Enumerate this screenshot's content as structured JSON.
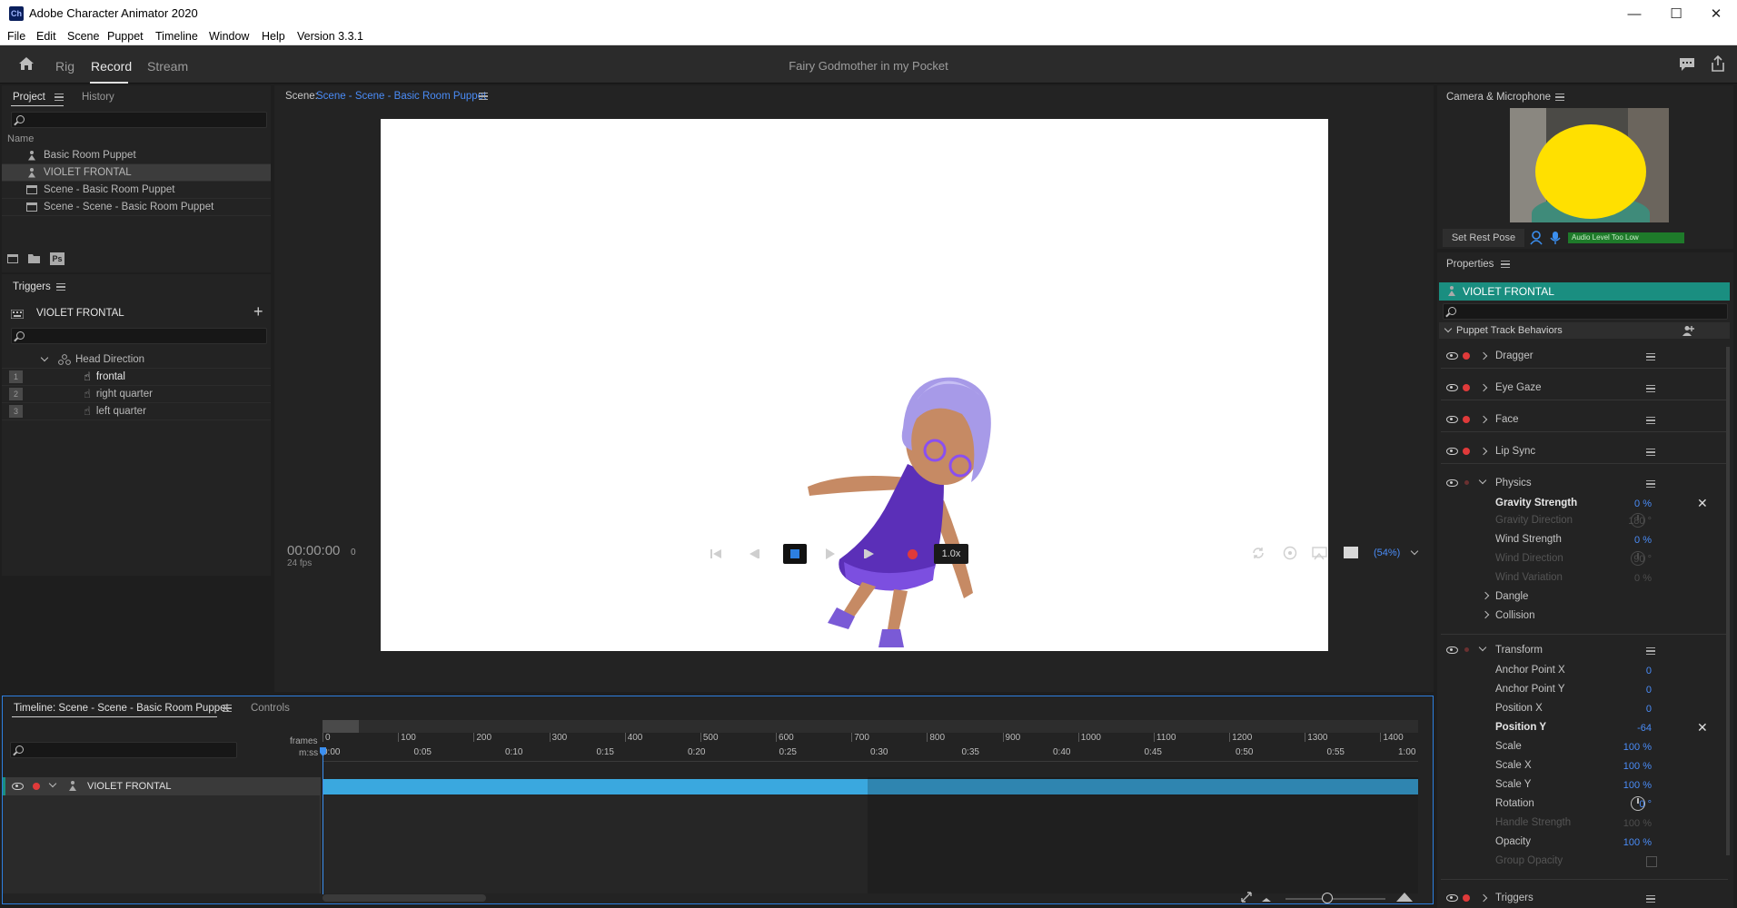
{
  "app": {
    "title": "Adobe Character Animator 2020",
    "icon_text": "Ch",
    "menu": [
      "File",
      "Edit",
      "Scene",
      "Puppet",
      "Timeline",
      "Window",
      "Help",
      "Version 3.3.1"
    ]
  },
  "workspaces": {
    "tabs": [
      "Rig",
      "Record",
      "Stream"
    ],
    "active": "Record",
    "document_title": "Fairy Godmother in my Pocket"
  },
  "project_panel": {
    "tabs": [
      "Project",
      "History"
    ],
    "column_header": "Name",
    "items": [
      {
        "type": "puppet",
        "name": "Basic Room Puppet"
      },
      {
        "type": "puppet",
        "name": "VIOLET FRONTAL",
        "selected": true
      },
      {
        "type": "scene",
        "name": "Scene - Basic Room Puppet"
      },
      {
        "type": "scene",
        "name": "Scene - Scene - Basic Room Puppet"
      }
    ],
    "footer_icons": [
      "new-scene-icon",
      "folder-icon",
      "photoshop-icon"
    ],
    "ps_label": "Ps"
  },
  "triggers_panel": {
    "title": "Triggers",
    "puppet": "VIOLET FRONTAL",
    "group": "Head Direction",
    "items": [
      {
        "key": "1",
        "name": "frontal",
        "active": true
      },
      {
        "key": "2",
        "name": "right quarter",
        "active": false
      },
      {
        "key": "3",
        "name": "left quarter",
        "active": false
      }
    ]
  },
  "scene_panel": {
    "label": "Scene:",
    "scene_name": "Scene - Scene - Basic Room Puppet",
    "timecode": "00:00:00",
    "frame": "0",
    "fps": "24 fps",
    "speed": "1.0x",
    "zoom": "(54%)"
  },
  "camera_panel": {
    "title": "Camera & Microphone",
    "set_rest_pose": "Set Rest Pose",
    "audio_status": "Audio Level Too Low"
  },
  "properties_panel": {
    "title": "Properties",
    "puppet": "VIOLET FRONTAL",
    "section": "Puppet Track Behaviors",
    "behaviors": [
      "Dragger",
      "Eye Gaze",
      "Face",
      "Lip Sync",
      "Physics",
      "Transform",
      "Triggers"
    ],
    "physics": {
      "gravity_strength": {
        "label": "Gravity Strength",
        "value": "0 %"
      },
      "gravity_direction": {
        "label": "Gravity Direction",
        "value": "180 °"
      },
      "wind_strength": {
        "label": "Wind Strength",
        "value": "0 %"
      },
      "wind_direction": {
        "label": "Wind Direction",
        "value": "90 °"
      },
      "wind_variation": {
        "label": "Wind Variation",
        "value": "0 %"
      },
      "dangle": "Dangle",
      "collision": "Collision"
    },
    "transform": {
      "anchor_x": {
        "label": "Anchor Point X",
        "value": "0"
      },
      "anchor_y": {
        "label": "Anchor Point Y",
        "value": "0"
      },
      "position_x": {
        "label": "Position X",
        "value": "0"
      },
      "position_y": {
        "label": "Position Y",
        "value": "-64"
      },
      "scale": {
        "label": "Scale",
        "value": "100 %"
      },
      "scale_x": {
        "label": "Scale X",
        "value": "100 %"
      },
      "scale_y": {
        "label": "Scale Y",
        "value": "100 %"
      },
      "rotation": {
        "label": "Rotation",
        "value": "0 °"
      },
      "handle_strength": {
        "label": "Handle Strength",
        "value": "100 %"
      },
      "opacity": {
        "label": "Opacity",
        "value": "100 %"
      },
      "group_opacity": {
        "label": "Group Opacity"
      }
    }
  },
  "timeline_panel": {
    "tabs": [
      "Timeline: Scene - Scene - Basic Room Puppet",
      "Controls"
    ],
    "frames_label": "frames",
    "mss_label": "m:ss",
    "frame_ticks": [
      "0",
      "100",
      "200",
      "300",
      "400",
      "500",
      "600",
      "700",
      "800",
      "900",
      "1000",
      "1100",
      "1200",
      "1300",
      "1400"
    ],
    "time_ticks": [
      "0:00",
      "0:05",
      "0:10",
      "0:15",
      "0:20",
      "0:25",
      "0:30",
      "0:35",
      "0:40",
      "0:45",
      "0:50",
      "0:55",
      "1:00"
    ],
    "track": "VIOLET FRONTAL"
  },
  "colors": {
    "accent_teal": "#1a8e80",
    "timeline_bar": "#3aa8df",
    "value_blue": "#4a8cf7",
    "record_red": "#e03a3a",
    "stop_blue": "#2d7fe0",
    "audio_green": "#1e7a2a"
  }
}
